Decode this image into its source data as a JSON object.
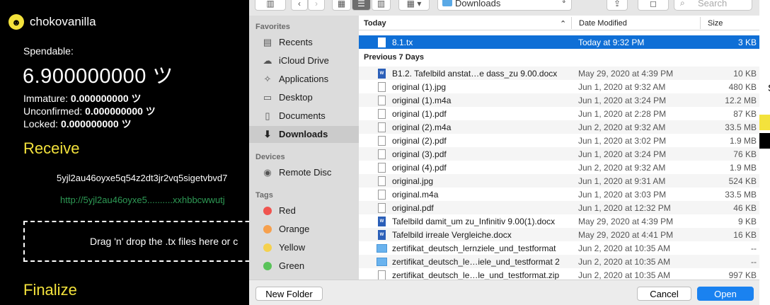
{
  "app": {
    "name": "chokovanilla",
    "spendable_label": "Spendable:",
    "spendable_value": "6.900000000 ツ",
    "immature_label": "Immature:",
    "immature_value": "0.000000000 ツ",
    "unconfirmed_label": "Unconfirmed:",
    "unconfirmed_value": "0.000000000 ツ",
    "locked_label": "Locked:",
    "locked_value": "0.000000000 ツ",
    "receive_title": "Receive",
    "address": "5yjl2au46oyxe5q54z2dt3jr2vq5sigetvbvd7",
    "address_link": "http://5yjl2au46oyxe5..........xxhbbcwwutj",
    "dropzone_text": "Drag 'n' drop the .tx files here or c",
    "finalize_title": "Finalize",
    "edge_letter": "S"
  },
  "dialog": {
    "location": "Downloads",
    "search_placeholder": "Search",
    "sidebar": {
      "favorites_header": "Favorites",
      "favorites": [
        {
          "label": "Recents",
          "icon": "clock-icon"
        },
        {
          "label": "iCloud Drive",
          "icon": "cloud-icon"
        },
        {
          "label": "Applications",
          "icon": "applications-icon"
        },
        {
          "label": "Desktop",
          "icon": "desktop-icon"
        },
        {
          "label": "Documents",
          "icon": "documents-icon"
        },
        {
          "label": "Downloads",
          "icon": "downloads-icon",
          "selected": true
        }
      ],
      "devices_header": "Devices",
      "devices": [
        {
          "label": "Remote Disc",
          "icon": "disc-icon"
        }
      ],
      "tags_header": "Tags",
      "tags": [
        {
          "label": "Red",
          "color": "#f0544f"
        },
        {
          "label": "Orange",
          "color": "#f6a04d"
        },
        {
          "label": "Yellow",
          "color": "#f5d14e"
        },
        {
          "label": "Green",
          "color": "#5ac35a"
        }
      ]
    },
    "columns": {
      "name": "Today",
      "date": "Date Modified",
      "size": "Size"
    },
    "group_previous": "Previous 7 Days",
    "today_files": [
      {
        "name": "8.1.tx",
        "date": "Today at 9:32 PM",
        "size": "3 KB",
        "type": "file",
        "selected": true
      }
    ],
    "previous_files": [
      {
        "name": "B1.2. Tafelbild anstat…e dass_zu 9.00.docx",
        "date": "May 29, 2020 at 4:39 PM",
        "size": "10 KB",
        "type": "doc"
      },
      {
        "name": "original (1).jpg",
        "date": "Jun 1, 2020 at 9:32 AM",
        "size": "480 KB",
        "type": "file"
      },
      {
        "name": "original (1).m4a",
        "date": "Jun 1, 2020 at 3:24 PM",
        "size": "12.2 MB",
        "type": "file"
      },
      {
        "name": "original (1).pdf",
        "date": "Jun 1, 2020 at 2:28 PM",
        "size": "87 KB",
        "type": "file"
      },
      {
        "name": "original (2).m4a",
        "date": "Jun 2, 2020 at 9:32 AM",
        "size": "33.5 MB",
        "type": "file"
      },
      {
        "name": "original (2).pdf",
        "date": "Jun 1, 2020 at 3:02 PM",
        "size": "1.9 MB",
        "type": "file"
      },
      {
        "name": "original (3).pdf",
        "date": "Jun 1, 2020 at 3:24 PM",
        "size": "76 KB",
        "type": "file"
      },
      {
        "name": "original (4).pdf",
        "date": "Jun 2, 2020 at 9:32 AM",
        "size": "1.9 MB",
        "type": "file"
      },
      {
        "name": "original.jpg",
        "date": "Jun 1, 2020 at 9:31 AM",
        "size": "524 KB",
        "type": "file"
      },
      {
        "name": "original.m4a",
        "date": "Jun 1, 2020 at 3:03 PM",
        "size": "33.5 MB",
        "type": "file"
      },
      {
        "name": "original.pdf",
        "date": "Jun 1, 2020 at 12:32 PM",
        "size": "46 KB",
        "type": "file"
      },
      {
        "name": "Tafelbild damit_um zu_Infinitiv 9.00(1).docx",
        "date": "May 29, 2020 at 4:39 PM",
        "size": "9 KB",
        "type": "doc"
      },
      {
        "name": "Tafelbild irreale Vergleiche.docx",
        "date": "May 29, 2020 at 4:41 PM",
        "size": "16 KB",
        "type": "doc"
      },
      {
        "name": "zertifikat_deutsch_lernziele_und_testformat",
        "date": "Jun 2, 2020 at 10:35 AM",
        "size": "--",
        "type": "folder"
      },
      {
        "name": "zertifikat_deutsch_le…iele_und_testformat 2",
        "date": "Jun 2, 2020 at 10:35 AM",
        "size": "--",
        "type": "folder"
      },
      {
        "name": "zertifikat_deutsch_le…le_und_testformat.zip",
        "date": "Jun 2, 2020 at 10:35 AM",
        "size": "997 KB",
        "type": "file"
      }
    ],
    "new_folder_label": "New Folder",
    "cancel_label": "Cancel",
    "open_label": "Open"
  }
}
